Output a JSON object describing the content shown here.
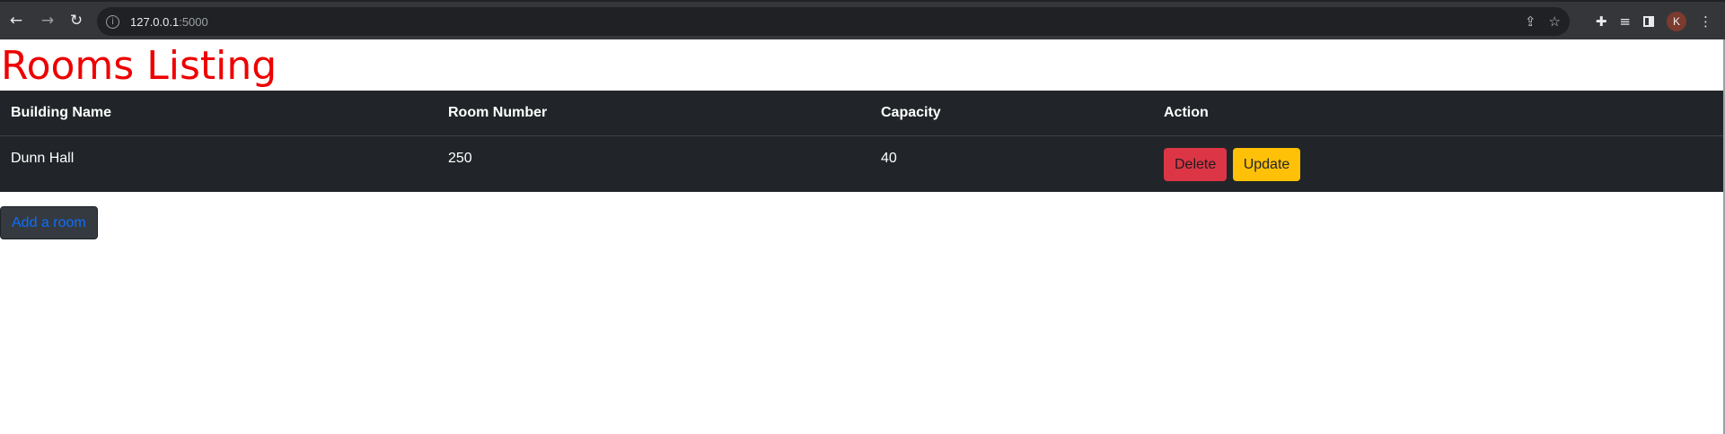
{
  "browser": {
    "url_host": "127.0.0.1",
    "url_port": ":5000",
    "profile_initial": "K"
  },
  "page": {
    "title": "Rooms Listing"
  },
  "table": {
    "headers": [
      "Building Name",
      "Room Number",
      "Capacity",
      "Action"
    ],
    "rows": [
      {
        "building_name": "Dunn Hall",
        "room_number": "250",
        "capacity": "40",
        "delete_label": "Delete",
        "update_label": "Update"
      }
    ]
  },
  "add_room_label": "Add a room",
  "colors": {
    "title": "#ee0000",
    "table_bg": "#212529",
    "delete_btn": "#dc3545",
    "update_btn": "#ffc107",
    "add_btn_text": "#0d6efd"
  },
  "icons": [
    "back-arrow-icon",
    "forward-arrow-icon",
    "reload-icon",
    "info-icon",
    "share-icon",
    "star-icon",
    "extensions-icon",
    "media-controls-icon",
    "side-panel-icon",
    "menu-icon"
  ]
}
